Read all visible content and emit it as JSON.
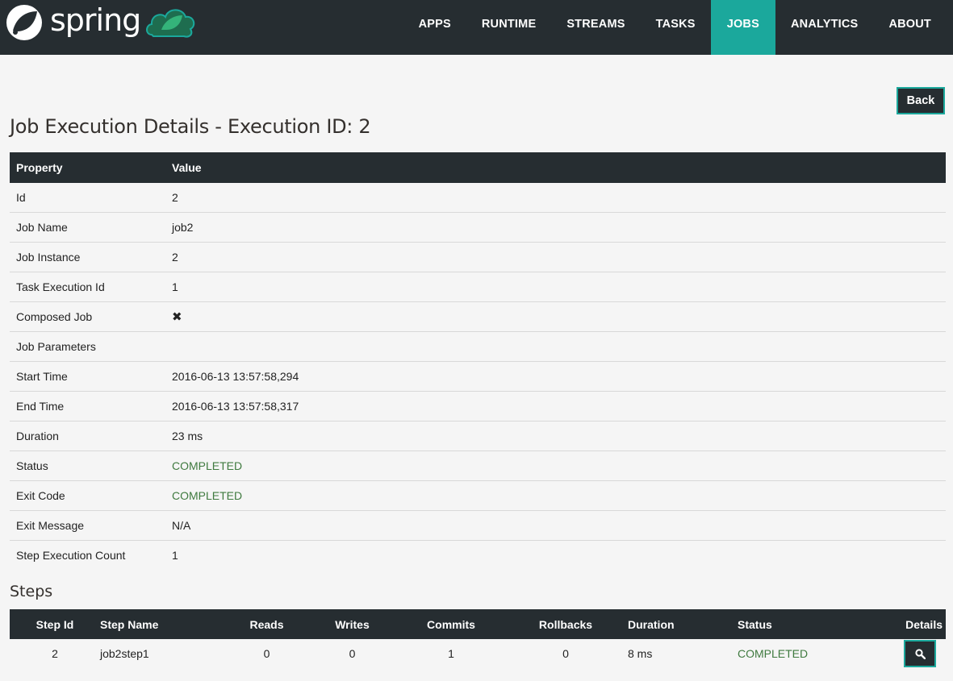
{
  "brand": {
    "name": "spring"
  },
  "nav": {
    "items": [
      {
        "label": "APPS"
      },
      {
        "label": "RUNTIME"
      },
      {
        "label": "STREAMS"
      },
      {
        "label": "TASKS"
      },
      {
        "label": "JOBS",
        "active": true
      },
      {
        "label": "ANALYTICS"
      },
      {
        "label": "ABOUT"
      }
    ]
  },
  "back_label": "Back",
  "page_title": "Job Execution Details - Execution ID: 2",
  "properties": {
    "headers": {
      "property": "Property",
      "value": "Value"
    },
    "rows": [
      {
        "property": "Id",
        "value": "2"
      },
      {
        "property": "Job Name",
        "value": "job2"
      },
      {
        "property": "Job Instance",
        "value": "2"
      },
      {
        "property": "Task Execution Id",
        "value": "1"
      },
      {
        "property": "Composed Job",
        "value": "✖"
      },
      {
        "property": "Job Parameters",
        "value": ""
      },
      {
        "property": "Start Time",
        "value": "2016-06-13 13:57:58,294"
      },
      {
        "property": "End Time",
        "value": "2016-06-13 13:57:58,317"
      },
      {
        "property": "Duration",
        "value": "23 ms"
      },
      {
        "property": "Status",
        "value": "COMPLETED"
      },
      {
        "property": "Exit Code",
        "value": "COMPLETED"
      },
      {
        "property": "Exit Message",
        "value": "N/A"
      },
      {
        "property": "Step Execution Count",
        "value": "1"
      }
    ]
  },
  "steps": {
    "title": "Steps",
    "headers": {
      "step_id": "Step Id",
      "step_name": "Step Name",
      "reads": "Reads",
      "writes": "Writes",
      "commits": "Commits",
      "rollbacks": "Rollbacks",
      "duration": "Duration",
      "status": "Status",
      "details": "Details"
    },
    "rows": [
      {
        "step_id": "2",
        "step_name": "job2step1",
        "reads": "0",
        "writes": "0",
        "commits": "1",
        "rollbacks": "0",
        "duration": "8 ms",
        "status": "COMPLETED",
        "details_icon": "search-icon"
      }
    ]
  },
  "colors": {
    "accent": "#1ba89c",
    "header_bg": "#262d31",
    "status_ok": "#3f7a3f"
  }
}
